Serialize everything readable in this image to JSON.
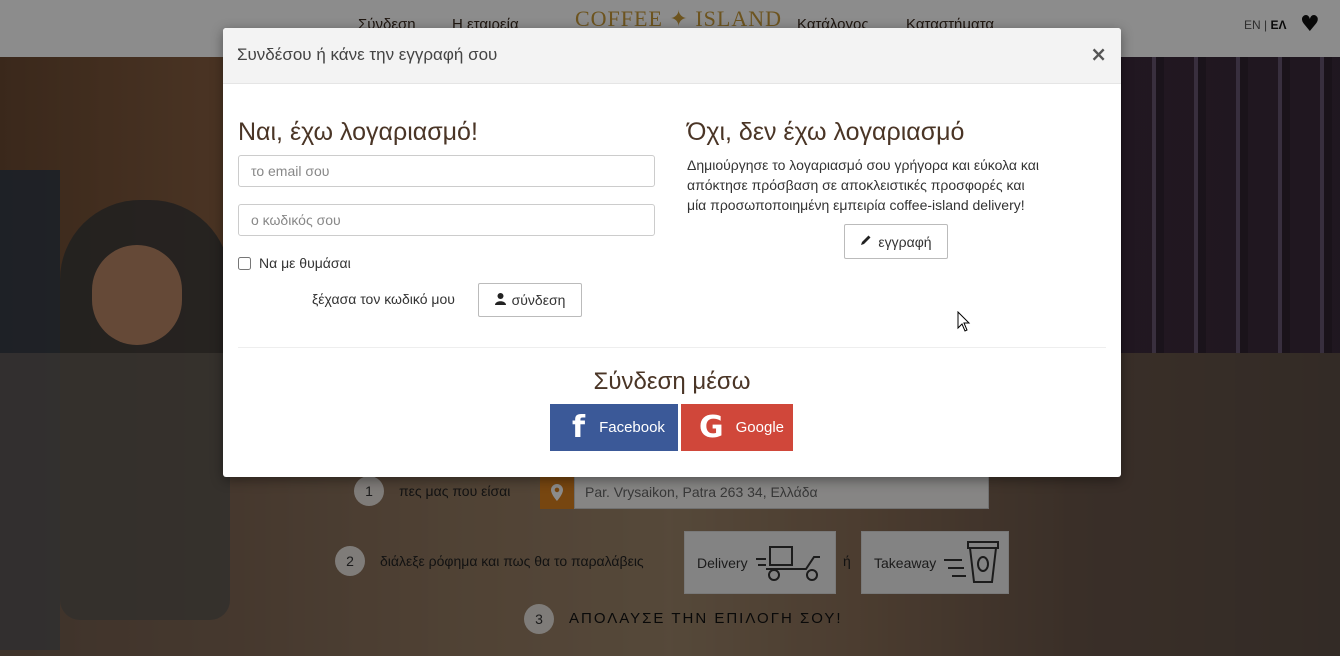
{
  "nav": {
    "links": [
      "Σύνδεση",
      "Η εταιρεία",
      "Κατάλογος",
      "Καταστήματα"
    ],
    "logo": "COFFEE ✦ ISLAND",
    "lang_en": "EN",
    "lang_sep": " | ",
    "lang_el": "ΕΛ",
    "heart": "♥"
  },
  "modal": {
    "title": "Συνδέσου ή κάνε την εγγραφή σου",
    "close": "×",
    "login": {
      "heading": "Ναι, έχω λογαριασμό!",
      "email_placeholder": "το email σου",
      "password_placeholder": "ο κωδικός σου",
      "remember_label": "Να με θυμάσαι",
      "forgot_label": "ξέχασα τον κωδικό μου",
      "submit_label": "σύνδεση"
    },
    "register": {
      "heading": "Όχι, δεν έχω λογαριασμό",
      "description": "Δημιούργησε το λογαριασμό σου γρήγορα και εύκολα και απόκτησε πρόσβαση σε αποκλειστικές προσφορές και μία προσωποποιημένη εμπειρία coffee-island delivery!",
      "button_label": "εγγραφή"
    },
    "social": {
      "heading": "Σύνδεση μέσω",
      "facebook_label": "Facebook",
      "google_label": "Google"
    }
  },
  "steps": {
    "step1_num": "1",
    "step1_label": "πες μας που είσαι",
    "address_value": "Par. Vrysaikon, Patra 263 34, Ελλάδα",
    "step2_num": "2",
    "step2_label": "διάλεξε ρόφημα και πως θα το παραλάβεις",
    "delivery_label": "Delivery",
    "or_label": "ή",
    "takeaway_label": "Takeaway",
    "step3_num": "3",
    "step3_label": "ΑΠΟΛΑΥΣΕ ΤΗΝ ΕΠΙΛΟΓΗ ΣΟΥ!"
  },
  "colors": {
    "facebook": "#3b5998",
    "google": "#d0473a",
    "accent": "#d9801e"
  }
}
